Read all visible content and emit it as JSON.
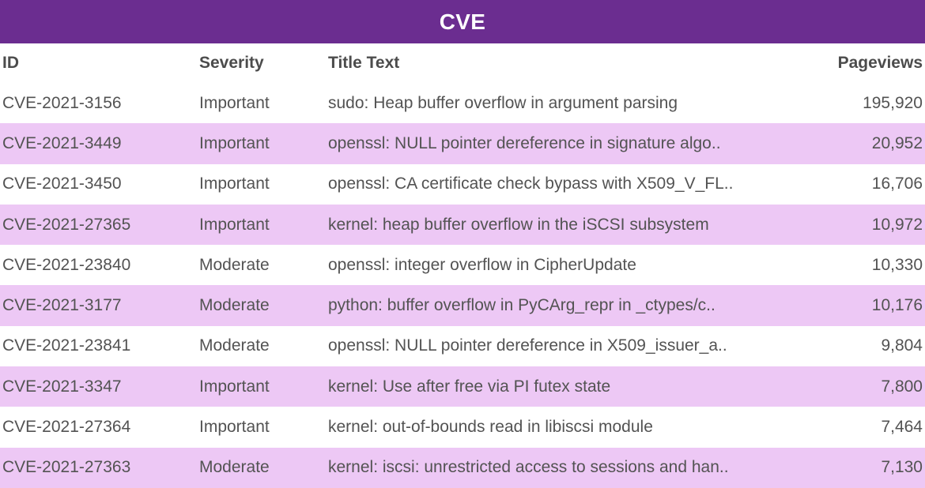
{
  "header": {
    "title": "CVE",
    "band_color": "#6b2d90",
    "title_color": "#ffffff"
  },
  "table": {
    "columns": [
      {
        "key": "id",
        "label": "ID",
        "align": "left"
      },
      {
        "key": "severity",
        "label": "Severity",
        "align": "left"
      },
      {
        "key": "title",
        "label": "Title Text",
        "align": "left"
      },
      {
        "key": "pageviews",
        "label": "Pageviews",
        "align": "right"
      }
    ],
    "row_colors": {
      "odd": "#ffffff",
      "even": "#edc8f5"
    },
    "rows": [
      {
        "id": "CVE-2021-3156",
        "severity": "Important",
        "title": "sudo: Heap buffer overflow in argument parsing",
        "pageviews": "195,920"
      },
      {
        "id": "CVE-2021-3449",
        "severity": "Important",
        "title": "openssl: NULL pointer dereference in signature algo..",
        "pageviews": "20,952"
      },
      {
        "id": "CVE-2021-3450",
        "severity": "Important",
        "title": "openssl: CA certificate check bypass with X509_V_FL..",
        "pageviews": "16,706"
      },
      {
        "id": "CVE-2021-27365",
        "severity": "Important",
        "title": "kernel: heap buffer overflow in the iSCSI subsystem",
        "pageviews": "10,972"
      },
      {
        "id": "CVE-2021-23840",
        "severity": "Moderate",
        "title": "openssl: integer overflow in CipherUpdate",
        "pageviews": "10,330"
      },
      {
        "id": "CVE-2021-3177",
        "severity": "Moderate",
        "title": "python: buffer overflow in PyCArg_repr in _ctypes/c..",
        "pageviews": "10,176"
      },
      {
        "id": "CVE-2021-23841",
        "severity": "Moderate",
        "title": "openssl: NULL pointer dereference in X509_issuer_a..",
        "pageviews": "9,804"
      },
      {
        "id": "CVE-2021-3347",
        "severity": "Important",
        "title": "kernel: Use after free via PI futex state",
        "pageviews": "7,800"
      },
      {
        "id": "CVE-2021-27364",
        "severity": "Important",
        "title": "kernel: out-of-bounds read in libiscsi module",
        "pageviews": "7,464"
      },
      {
        "id": "CVE-2021-27363",
        "severity": "Moderate",
        "title": "kernel: iscsi: unrestricted access to sessions and han..",
        "pageviews": "7,130"
      }
    ]
  }
}
